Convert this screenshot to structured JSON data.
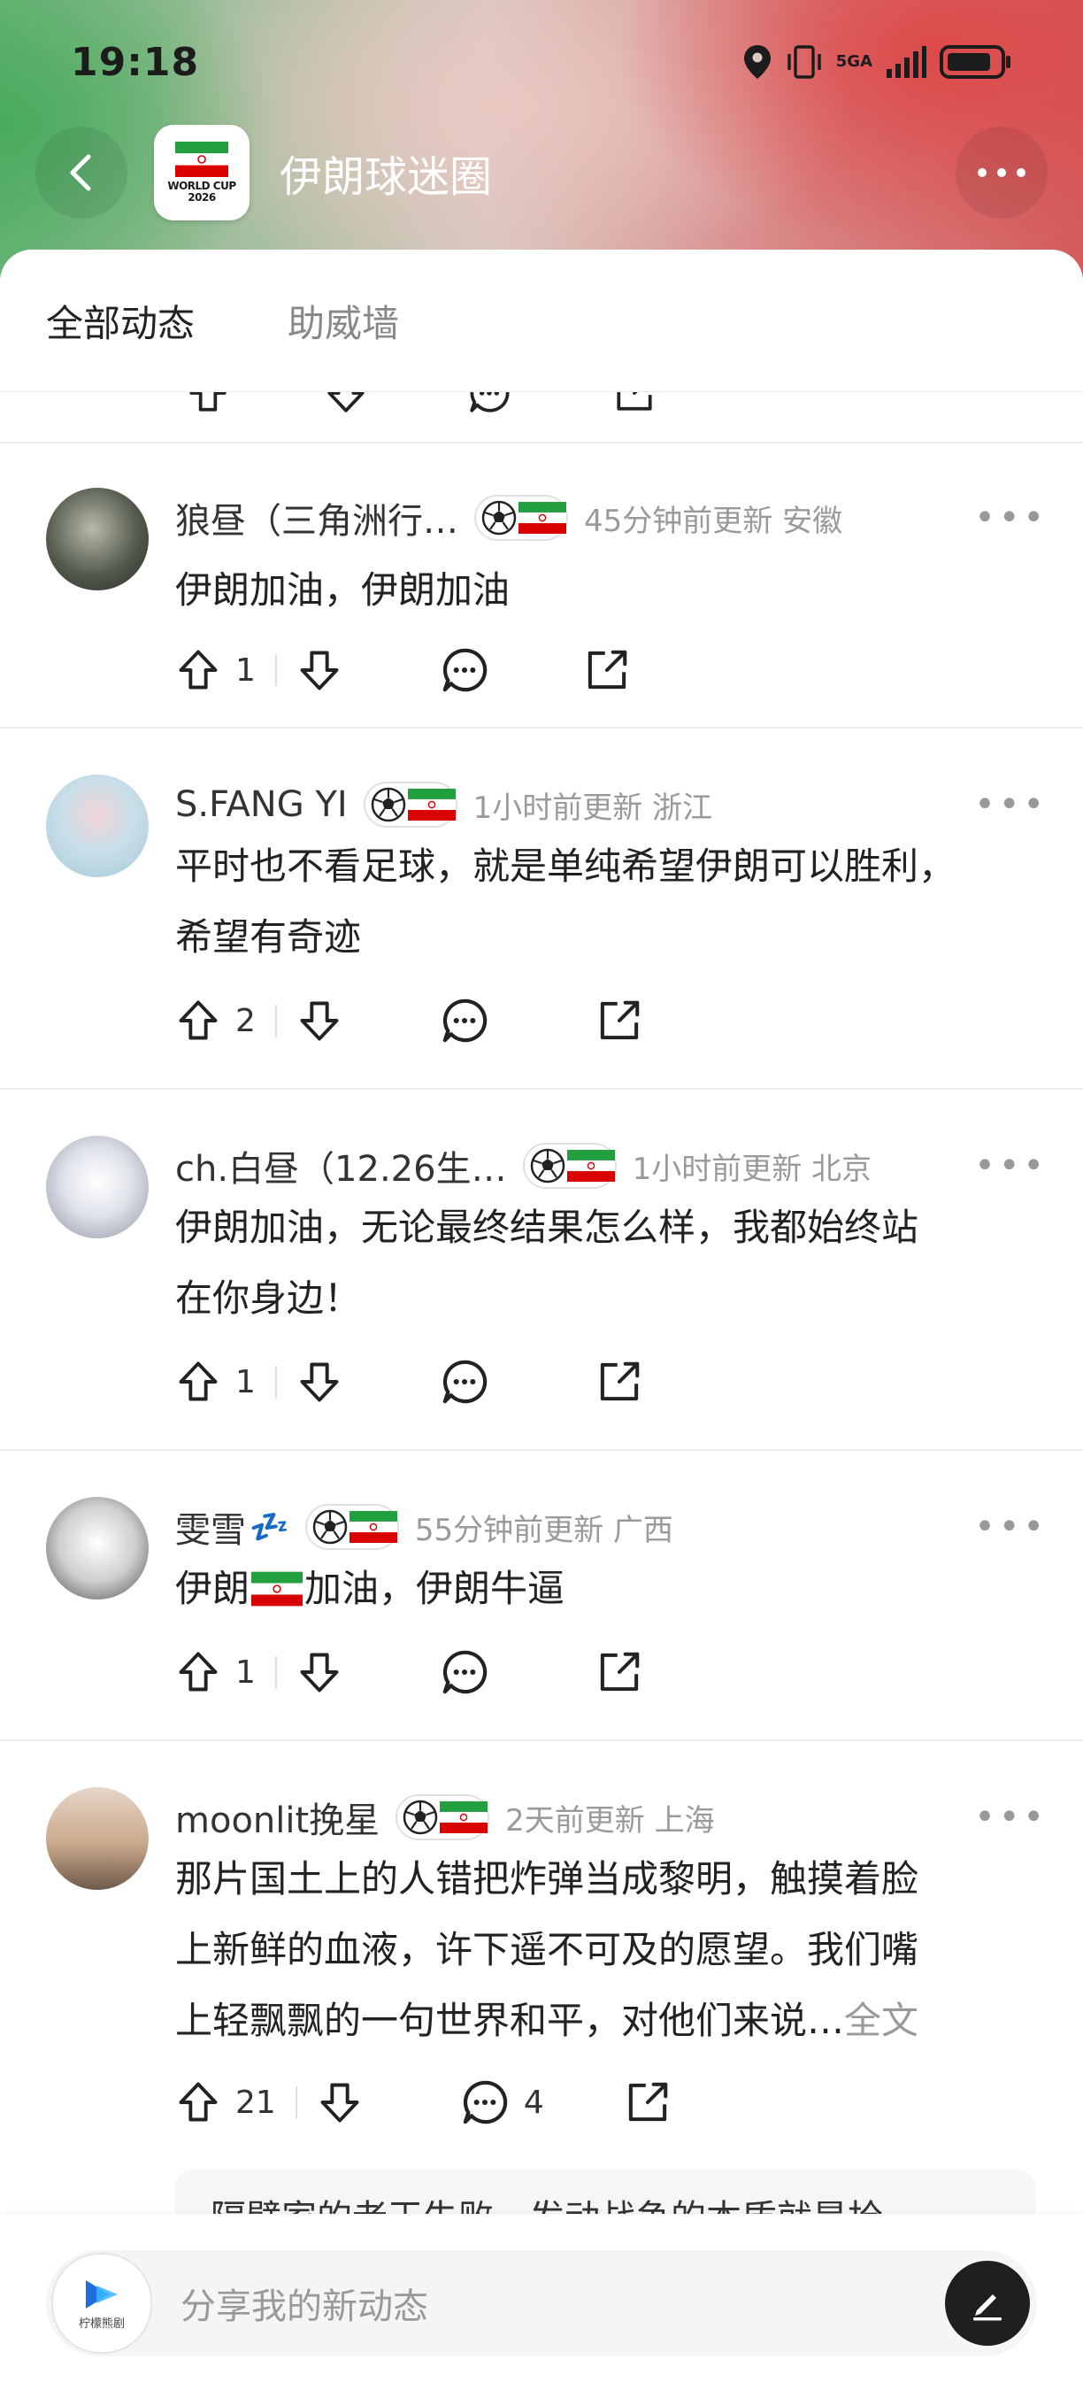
{
  "status_bar": {
    "time": "19:18",
    "network": "5GA"
  },
  "header": {
    "title": "伊朗球迷圈",
    "logo_text": "WORLD CUP 2026"
  },
  "tabs": [
    {
      "label": "全部动态",
      "active": true
    },
    {
      "label": "助威墙",
      "active": false
    }
  ],
  "posts": [
    {
      "username": "狼昼（三角洲行…",
      "meta": "45分钟前更新 安徽",
      "lines": [
        "伊朗加油，伊朗加油"
      ],
      "full_text": "",
      "upvotes": "1",
      "comments": ""
    },
    {
      "username": "S.FANG YI",
      "meta": "1小时前更新 浙江",
      "lines": [
        "平时也不看足球，就是单纯希望伊朗可以胜利，",
        "希望有奇迹"
      ],
      "full_text": "",
      "upvotes": "2",
      "comments": ""
    },
    {
      "username": "ch.白昼（12.26生…",
      "meta": "1小时前更新 北京",
      "lines": [
        "伊朗加油，无论最终结果怎么样，我都始终站",
        "在你身边！"
      ],
      "full_text": "",
      "upvotes": "1",
      "comments": ""
    },
    {
      "username": "雯雪",
      "username_suffix": "💤",
      "meta": "55分钟前更新 广西",
      "body_before_flag": "伊朗",
      "body_after_flag": "加油，伊朗牛逼",
      "upvotes": "1",
      "comments": ""
    },
    {
      "username": "moonlit挽星",
      "meta": "2天前更新 上海",
      "lines": [
        "那片国土上的人错把炸弹当成黎明，触摸着脸",
        "上新鲜的血液，许下遥不可及的愿望。我们嘴",
        "上轻飘飘的一句世界和平，对他们来说…"
      ],
      "full_text": "全文",
      "upvotes": "21",
      "comments": "4"
    }
  ],
  "reply_preview": "隔壁家的老王失败，发动战争的本质就是抢",
  "composer": {
    "placeholder": "分享我的新动态",
    "avatar_text": "柠檬熊剧"
  },
  "colors": {
    "iran_green": "#239f40",
    "iran_red": "#da0000",
    "accent_dark": "#1e1e1e"
  }
}
